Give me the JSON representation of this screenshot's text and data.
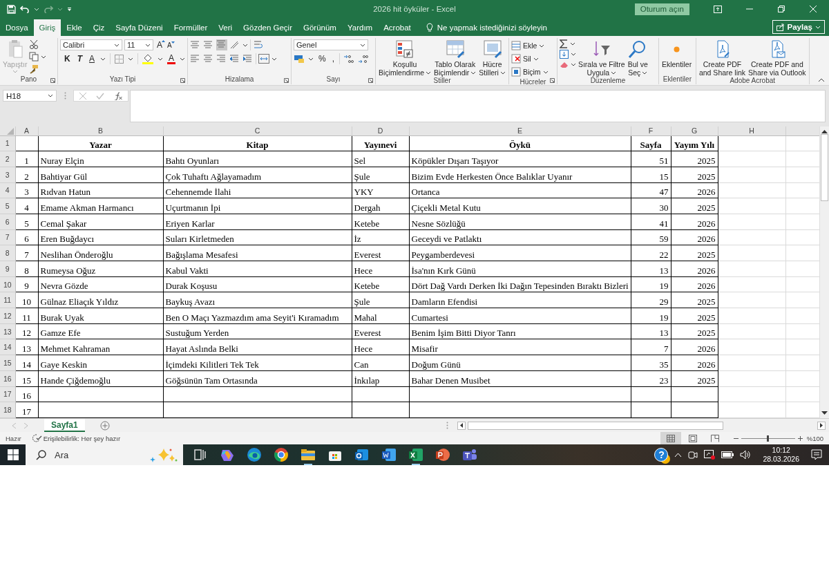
{
  "title_bar": {
    "title": "2026 hit öyküler  -  Excel",
    "sign_in": "Oturum açın"
  },
  "menu": {
    "tabs": [
      {
        "label": "Dosya",
        "selected": false
      },
      {
        "label": "Giriş",
        "selected": true
      },
      {
        "label": "Ekle",
        "selected": false
      },
      {
        "label": "Çiz",
        "selected": false
      },
      {
        "label": "Sayfa Düzeni",
        "selected": false
      },
      {
        "label": "Formüller",
        "selected": false
      },
      {
        "label": "Veri",
        "selected": false
      },
      {
        "label": "Gözden Geçir",
        "selected": false
      },
      {
        "label": "Görünüm",
        "selected": false
      },
      {
        "label": "Yardım",
        "selected": false
      },
      {
        "label": "Acrobat",
        "selected": false
      }
    ],
    "tell_me": "Ne yapmak istediğinizi söyleyin",
    "share": "Paylaş"
  },
  "ribbon": {
    "groups": [
      {
        "kind": "clipboard",
        "label": "Pano",
        "paste": {
          "label": "Yapıştır",
          "disabled": true
        }
      },
      {
        "kind": "font",
        "label": "Yazı Tipi",
        "font": "Calibri",
        "size": "11",
        "grow": "A",
        "shrink": "A",
        "bold": "K",
        "italic": "T",
        "underline": "A",
        "font_color": "A"
      },
      {
        "kind": "alignment",
        "label": "Hizalama"
      },
      {
        "kind": "number",
        "label": "Sayı",
        "format": "Genel",
        "percent": "%",
        "comma": ","
      },
      {
        "kind": "styles",
        "label": "Stiller",
        "buttons": [
          {
            "lines": [
              "Koşullu",
              "Biçimlendirme"
            ]
          },
          {
            "lines": [
              "Tablo Olarak",
              "Biçimlendir"
            ]
          },
          {
            "lines": [
              "Hücre",
              "Stilleri"
            ]
          }
        ]
      },
      {
        "kind": "cells",
        "label": "Hücreler",
        "buttons": [
          {
            "lines": [
              "Ekle"
            ]
          },
          {
            "lines": [
              "Sil"
            ]
          },
          {
            "lines": [
              "Biçim"
            ]
          }
        ]
      },
      {
        "kind": "editing",
        "label": "Düzenleme",
        "buttons": [
          {
            "lines": [
              "Sırala ve Filtre",
              "Uygula"
            ]
          },
          {
            "lines": [
              "Bul ve",
              "Seç"
            ]
          }
        ]
      },
      {
        "kind": "addins",
        "label": "Eklentiler",
        "buttons": [
          {
            "lines": [
              "Eklentiler"
            ]
          }
        ]
      },
      {
        "kind": "acrobat",
        "label": "Adobe Acrobat",
        "buttons": [
          {
            "lines": [
              "Create PDF",
              "and Share link"
            ]
          },
          {
            "lines": [
              "Create PDF and",
              "Share via Outlook"
            ]
          }
        ]
      }
    ]
  },
  "name_box": "H18",
  "sheet": {
    "columns": [
      "A",
      "B",
      "C",
      "D",
      "E",
      "F",
      "G",
      "H"
    ],
    "header_row": {
      "number": "1",
      "titles": [
        "Yazar",
        "Kitap",
        "Yayınevi",
        "Öykü",
        "Sayfa",
        "Yayım Yılı"
      ]
    },
    "rows": [
      {
        "number": "2",
        "index": "1",
        "author": "Nuray Elçin",
        "book": "Bahtı Oyunları",
        "publisher": "Sel",
        "story": "Köpükler Dışarı Taşıyor",
        "pages": "51",
        "year": "2025"
      },
      {
        "number": "3",
        "index": "2",
        "author": "Bahtiyar Gül",
        "book": "Çok Tuhaftı Ağlayamadım",
        "publisher": "Şule",
        "story": "Bizim Evde Herkesten Önce Balıklar Uyanır",
        "pages": "15",
        "year": "2025"
      },
      {
        "number": "4",
        "index": "3",
        "author": "Rıdvan Hatun",
        "book": "Cehennemde İlahi",
        "publisher": "YKY",
        "story": "Ortanca",
        "pages": "47",
        "year": "2026"
      },
      {
        "number": "5",
        "index": "4",
        "author": "Emame Akman Harmancı",
        "book": "Uçurtmanın İpi",
        "publisher": "Dergah",
        "story": "Çiçekli Metal Kutu",
        "pages": "30",
        "year": "2025"
      },
      {
        "number": "6",
        "index": "5",
        "author": "Cemal Şakar",
        "book": "Eriyen Karlar",
        "publisher": "Ketebe",
        "story": "Nesne Sözlüğü",
        "pages": "41",
        "year": "2026"
      },
      {
        "number": "7",
        "index": "6",
        "author": "Eren Buğdaycı",
        "book": "Suları Kirletmeden",
        "publisher": "İz",
        "story": "Geceydi ve Patlaktı",
        "pages": "59",
        "year": "2026"
      },
      {
        "number": "8",
        "index": "7",
        "author": "Neslihan Önderoğlu",
        "book": "Bağışlama Mesafesi",
        "publisher": "Everest",
        "story": "Peygamberdevesi",
        "pages": "22",
        "year": "2025"
      },
      {
        "number": "9",
        "index": "8",
        "author": "Rumeysa Oğuz",
        "book": "Kabul Vakti",
        "publisher": "Hece",
        "story": "İsa'nın Kırk Günü",
        "pages": "13",
        "year": "2026"
      },
      {
        "number": "10",
        "index": "9",
        "author": "Nevra Gözde",
        "book": "Durak Koşusu",
        "publisher": "Ketebe",
        "story": "Dört Dağ Vardı Derken İki Dağın Tepesinden Bıraktı Bizleri",
        "pages": "19",
        "year": "2026"
      },
      {
        "number": "11",
        "index": "10",
        "author": "Gülnaz Eliaçık Yıldız",
        "book": "Baykuş Avazı",
        "publisher": "Şule",
        "story": "Damların Efendisi",
        "pages": "29",
        "year": "2025"
      },
      {
        "number": "12",
        "index": "11",
        "author": "Burak Uyak",
        "book": "Ben O Maçı Yazmazdım ama Seyit'i Kıramadım",
        "publisher": "Mahal",
        "story": "Cumartesi",
        "pages": "19",
        "year": "2025"
      },
      {
        "number": "13",
        "index": "12",
        "author": "Gamze Efe",
        "book": "Sustuğum Yerden",
        "publisher": "Everest",
        "story": "Benim İşim Bitti Diyor Tanrı",
        "pages": "13",
        "year": "2025"
      },
      {
        "number": "14",
        "index": "13",
        "author": "Mehmet Kahraman",
        "book": "Hayat Aslında Belki",
        "publisher": "Hece",
        "story": "Misafir",
        "pages": "7",
        "year": "2026"
      },
      {
        "number": "15",
        "index": "14",
        "author": "Gaye Keskin",
        "book": "İçimdeki Kilitleri Tek Tek",
        "publisher": "Can",
        "story": "Doğum Günü",
        "pages": "35",
        "year": "2026"
      },
      {
        "number": "16",
        "index": "15",
        "author": "Hande Çiğdemoğlu",
        "book": "Göğsünün Tam Ortasında",
        "publisher": "İnkılap",
        "story": "Bahar Denen Musibet",
        "pages": "23",
        "year": "2025"
      },
      {
        "number": "17",
        "index": "16"
      },
      {
        "number": "18",
        "index": "17"
      }
    ]
  },
  "sheet_tabs": [
    {
      "label": "Sayfa1",
      "selected": true
    }
  ],
  "status_bar": {
    "ready": "Hazır",
    "accessibility": "Erişilebilirlik: Her şey hazır",
    "views": [
      {
        "selected": true
      },
      {
        "selected": false
      },
      {
        "selected": false
      }
    ],
    "zoom_slider": {
      "level": 0.49
    },
    "zoom": "%100"
  },
  "taskbar": {
    "search_placeholder": "Ara",
    "apps": [
      {
        "running": false
      },
      {
        "running": false
      },
      {
        "running": false
      },
      {
        "running": false
      },
      {
        "running": true
      },
      {
        "running": false
      },
      {
        "running": false
      },
      {
        "running": false
      },
      {
        "running": true
      },
      {
        "running": false
      },
      {
        "running": false
      }
    ],
    "help": "?",
    "time": "10:12",
    "date": "28.03.2026"
  }
}
